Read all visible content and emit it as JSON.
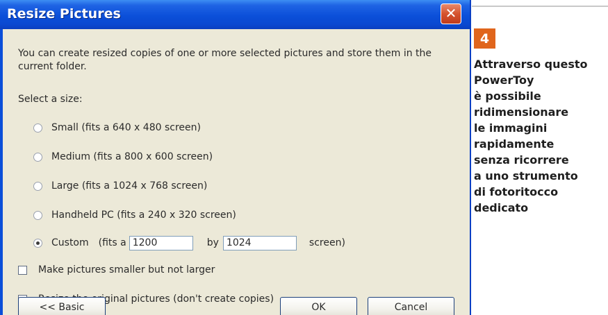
{
  "dialog": {
    "title": "Resize Pictures",
    "close_symbol": "✕",
    "description": "You can create resized copies of one or more selected pictures and store them in the current folder.",
    "select_size_label": "Select a size:",
    "options": [
      {
        "label": "Small (fits a 640 x 480 screen)",
        "selected": false
      },
      {
        "label": "Medium (fits a 800 x 600 screen)",
        "selected": false
      },
      {
        "label": "Large (fits a 1024 x 768 screen)",
        "selected": false
      },
      {
        "label": "Handheld PC (fits a 240 x 320 screen)",
        "selected": false
      }
    ],
    "custom": {
      "label": "Custom",
      "fits_a": "(fits a",
      "width": "1200",
      "by": "by",
      "height": "1024",
      "screen": "screen)",
      "selected": true
    },
    "checkboxes": [
      {
        "label": "Make pictures smaller but not larger",
        "checked": false
      },
      {
        "label": "Resize the original pictures (don't create copies)",
        "checked": false
      }
    ],
    "buttons": {
      "basic": "<< Basic",
      "ok": "OK",
      "cancel": "Cancel"
    }
  },
  "side": {
    "number": "4",
    "caption": "Attraverso questo\nPowerToy\nè possibile\nridimensionare\nle immagini\nrapidamente\nsenza ricorrere\na uno strumento\ndi fotoritocco\ndedicato"
  },
  "colors": {
    "titlebar": "#0b4fd9",
    "dialog_bg": "#ece9d8",
    "badge": "#e0651c"
  }
}
